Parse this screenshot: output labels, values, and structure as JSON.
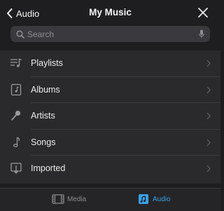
{
  "header": {
    "back_label": "Audio",
    "title": "My Music"
  },
  "search": {
    "placeholder": "Search"
  },
  "rows": [
    {
      "label": "Playlists",
      "icon": "playlist-icon"
    },
    {
      "label": "Albums",
      "icon": "album-icon"
    },
    {
      "label": "Artists",
      "icon": "microphone-icon"
    },
    {
      "label": "Songs",
      "icon": "music-note-icon"
    },
    {
      "label": "Imported",
      "icon": "import-icon"
    }
  ],
  "tabs": {
    "media_label": "Media",
    "audio_label": "Audio"
  },
  "colors": {
    "accent": "#3aa0e8",
    "background": "#1e1e20",
    "list_bg": "#2a2a2c"
  }
}
